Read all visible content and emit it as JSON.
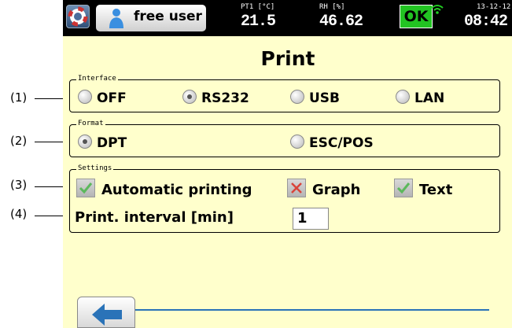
{
  "status": {
    "user_label": "free user",
    "sensor1_label": "PT1 [°C]",
    "sensor1_value": "21.5",
    "sensor2_label": "RH [%]",
    "sensor2_value": "46.62",
    "ok_label": "OK",
    "date": "13-12-12",
    "time": "08:42"
  },
  "page_title": "Print",
  "interface": {
    "legend": "Interface",
    "options": [
      "OFF",
      "RS232",
      "USB",
      "LAN"
    ],
    "selected": "RS232"
  },
  "format": {
    "legend": "Format",
    "options": [
      "DPT",
      "ESC/POS"
    ],
    "selected": "DPT"
  },
  "settings": {
    "legend": "Settings",
    "automatic_printing": "Automatic printing",
    "graph": "Graph",
    "text": "Text",
    "automatic_printing_checked": true,
    "graph_checked": false,
    "text_checked": true,
    "interval_label": "Print. interval [min]",
    "interval_value": "1"
  },
  "callouts": [
    "(1)",
    "(2)",
    "(3)",
    "(4)"
  ],
  "colors": {
    "screen_bg": "#ffffcc",
    "ok_green": "#22c322",
    "check_green": "#5cb85c",
    "cross_red": "#d9443a",
    "accent_blue": "#2a73b8"
  }
}
